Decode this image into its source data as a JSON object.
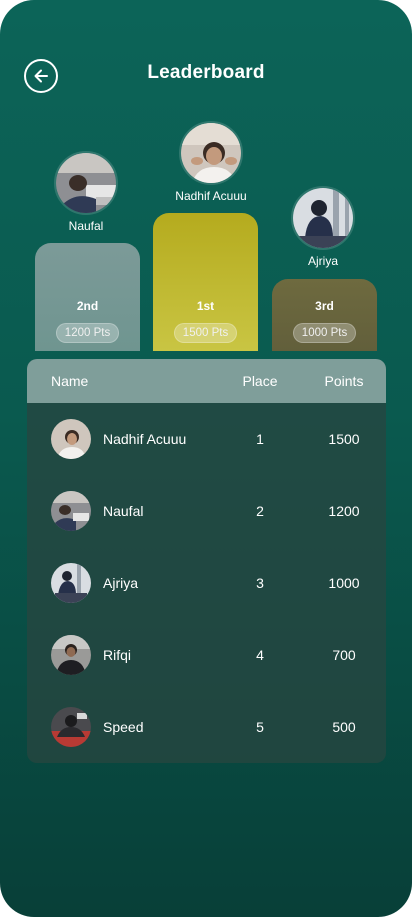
{
  "header": {
    "title": "Leaderboard"
  },
  "podium": [
    {
      "rank_label": "2nd",
      "name": "Naufal",
      "points": "1200 Pts"
    },
    {
      "rank_label": "1st",
      "name": "Nadhif Acuuu",
      "points": "1500 Pts"
    },
    {
      "rank_label": "3rd",
      "name": "Ajriya",
      "points": "1000 Pts"
    }
  ],
  "table": {
    "headers": {
      "name": "Name",
      "place": "Place",
      "points": "Points"
    },
    "rows": [
      {
        "name": "Nadhif Acuuu",
        "place": "1",
        "points": "1500"
      },
      {
        "name": "Naufal",
        "place": "2",
        "points": "1200"
      },
      {
        "name": "Ajriya",
        "place": "3",
        "points": "1000"
      },
      {
        "name": "Rifqi",
        "place": "4",
        "points": "700"
      },
      {
        "name": "Speed",
        "place": "5",
        "points": "500"
      }
    ]
  },
  "colors": {
    "background_top": "#0c6458",
    "background_bottom": "#083f38",
    "first_place": "#c9c543",
    "second_place": "#7c9a98",
    "third_place": "#6e6a3f",
    "table_header": "#7f9e9a"
  }
}
